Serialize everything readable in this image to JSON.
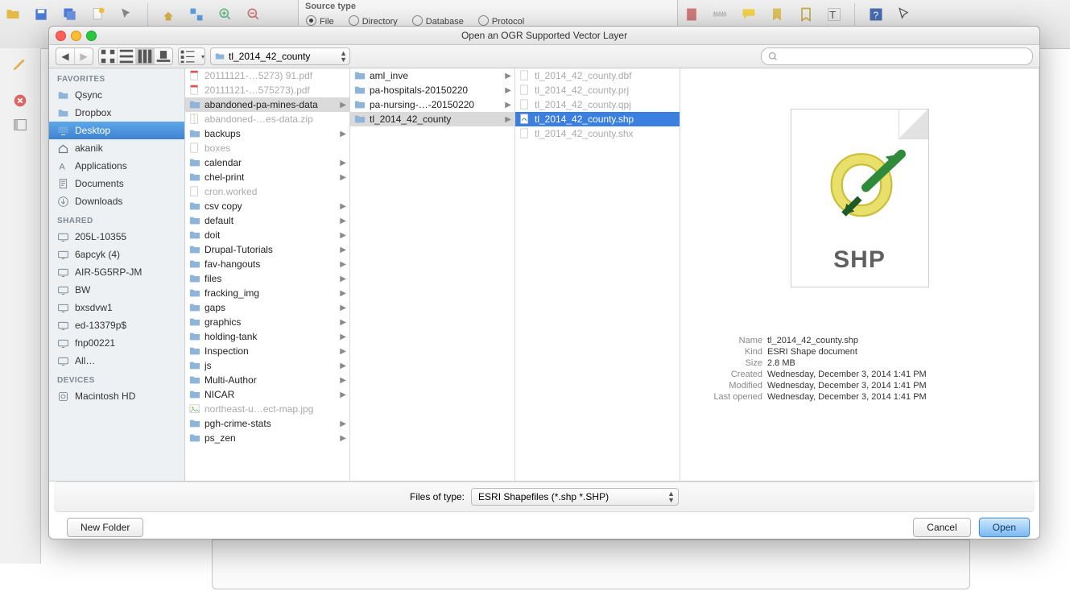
{
  "bg": {
    "source_type_label": "Source type",
    "radios": [
      "File",
      "Directory",
      "Database",
      "Protocol"
    ]
  },
  "dialog": {
    "title": "Open an OGR Supported Vector Layer",
    "path_current": "tl_2014_42_county",
    "search_placeholder": "",
    "sidebar": {
      "groups": [
        {
          "label": "FAVORITES",
          "items": [
            {
              "icon": "folder",
              "label": "Qsync"
            },
            {
              "icon": "folder",
              "label": "Dropbox"
            },
            {
              "icon": "desktop",
              "label": "Desktop",
              "selected": true
            },
            {
              "icon": "home",
              "label": "akanik"
            },
            {
              "icon": "apps",
              "label": "Applications"
            },
            {
              "icon": "docs",
              "label": "Documents"
            },
            {
              "icon": "down",
              "label": "Downloads"
            }
          ]
        },
        {
          "label": "SHARED",
          "items": [
            {
              "icon": "mon",
              "label": "205L-10355"
            },
            {
              "icon": "mon",
              "label": "6apcyk (4)"
            },
            {
              "icon": "mon",
              "label": "AIR-5G5RP-JM"
            },
            {
              "icon": "mon",
              "label": "BW"
            },
            {
              "icon": "mon",
              "label": "bxsdvw1"
            },
            {
              "icon": "mon",
              "label": "ed-13379p$"
            },
            {
              "icon": "mon",
              "label": "fnp00221"
            },
            {
              "icon": "mon",
              "label": "All…"
            }
          ]
        },
        {
          "label": "DEVICES",
          "items": [
            {
              "icon": "hdd",
              "label": "Macintosh HD"
            }
          ]
        }
      ]
    },
    "col1": [
      {
        "icon": "pdf",
        "label": "20111121-…5273) 91.pdf",
        "dim": true
      },
      {
        "icon": "pdf",
        "label": "20111121-…575273).pdf",
        "dim": true
      },
      {
        "icon": "folder",
        "label": "abandoned-pa-mines-data",
        "arrow": true,
        "sel": "soft"
      },
      {
        "icon": "zip",
        "label": "abandoned-…es-data.zip",
        "dim": true
      },
      {
        "icon": "folder",
        "label": "backups",
        "arrow": true
      },
      {
        "icon": "file",
        "label": "boxes",
        "dim": true
      },
      {
        "icon": "folder",
        "label": "calendar",
        "arrow": true
      },
      {
        "icon": "folder",
        "label": "chel-print",
        "arrow": true
      },
      {
        "icon": "file",
        "label": "cron.worked",
        "dim": true
      },
      {
        "icon": "folder",
        "label": "csv copy",
        "arrow": true
      },
      {
        "icon": "folder",
        "label": "default",
        "arrow": true
      },
      {
        "icon": "folder",
        "label": "doit",
        "arrow": true
      },
      {
        "icon": "folder",
        "label": "Drupal-Tutorials",
        "arrow": true
      },
      {
        "icon": "folder",
        "label": "fav-hangouts",
        "arrow": true
      },
      {
        "icon": "folder",
        "label": "files",
        "arrow": true
      },
      {
        "icon": "folder",
        "label": "fracking_img",
        "arrow": true
      },
      {
        "icon": "folder",
        "label": "gaps",
        "arrow": true
      },
      {
        "icon": "folder",
        "label": "graphics",
        "arrow": true
      },
      {
        "icon": "folder",
        "label": "holding-tank",
        "arrow": true
      },
      {
        "icon": "folder",
        "label": "Inspection",
        "arrow": true
      },
      {
        "icon": "folder",
        "label": "js",
        "arrow": true
      },
      {
        "icon": "folder",
        "label": "Multi-Author",
        "arrow": true
      },
      {
        "icon": "folder",
        "label": "NICAR",
        "arrow": true
      },
      {
        "icon": "img",
        "label": "northeast-u…ect-map.jpg",
        "dim": true
      },
      {
        "icon": "folder",
        "label": "pgh-crime-stats",
        "arrow": true
      },
      {
        "icon": "folder",
        "label": "ps_zen",
        "arrow": true
      }
    ],
    "col2": [
      {
        "icon": "folder",
        "label": "aml_inve",
        "arrow": true
      },
      {
        "icon": "folder",
        "label": "pa-hospitals-20150220",
        "arrow": true
      },
      {
        "icon": "folder",
        "label": "pa-nursing-…-20150220",
        "arrow": true
      },
      {
        "icon": "folder",
        "label": "tl_2014_42_county",
        "arrow": true,
        "sel": "soft"
      }
    ],
    "col3": [
      {
        "icon": "file",
        "label": "tl_2014_42_county.dbf",
        "dim": true
      },
      {
        "icon": "file",
        "label": "tl_2014_42_county.prj",
        "dim": true
      },
      {
        "icon": "file",
        "label": "tl_2014_42_county.qpj",
        "dim": true
      },
      {
        "icon": "shp",
        "label": "tl_2014_42_county.shp",
        "sel": "hard"
      },
      {
        "icon": "file",
        "label": "tl_2014_42_county.shx",
        "dim": true
      }
    ],
    "preview": {
      "badge": "SHP",
      "meta": [
        {
          "k": "Name",
          "v": "tl_2014_42_county.shp"
        },
        {
          "k": "Kind",
          "v": "ESRI Shape document"
        },
        {
          "k": "Size",
          "v": "2.8 MB"
        },
        {
          "k": "Created",
          "v": "Wednesday, December 3, 2014 1:41 PM"
        },
        {
          "k": "Modified",
          "v": "Wednesday, December 3, 2014 1:41 PM"
        },
        {
          "k": "Last opened",
          "v": "Wednesday, December 3, 2014 1:41 PM"
        }
      ]
    },
    "filter": {
      "label": "Files of type:",
      "value": "ESRI Shapefiles (*.shp *.SHP)"
    },
    "buttons": {
      "new_folder": "New Folder",
      "cancel": "Cancel",
      "open": "Open"
    }
  }
}
